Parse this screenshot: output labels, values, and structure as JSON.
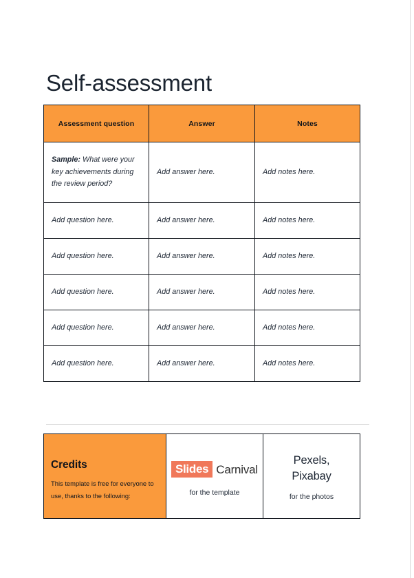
{
  "slide": {
    "title": "Self-assessment"
  },
  "table": {
    "headers": [
      "Assessment question",
      "Answer",
      "Notes"
    ],
    "rows": [
      {
        "question_label": "Sample:",
        "question": " What were your key achievements during the review period?",
        "answer": "Add answer here.",
        "notes": "Add notes here."
      },
      {
        "question": "Add question here.",
        "answer": "Add answer here.",
        "notes": "Add notes here."
      },
      {
        "question": "Add question here.",
        "answer": "Add answer here.",
        "notes": "Add notes here."
      },
      {
        "question": "Add question here.",
        "answer": "Add answer here.",
        "notes": "Add notes here."
      },
      {
        "question": "Add question here.",
        "answer": "Add answer here.",
        "notes": "Add notes here."
      },
      {
        "question": "Add question here.",
        "answer": "Add answer here.",
        "notes": "Add notes here."
      }
    ]
  },
  "credits": {
    "heading": "Credits",
    "body": "This template is free for everyone to use, thanks to the following:",
    "template_logo_part1": "Slides",
    "template_logo_part2": "Carnival",
    "template_caption": "for the template",
    "photos_names": "Pexels, Pixabay",
    "photos_name_line1": "Pexels,",
    "photos_name_line2": "Pixabay",
    "photos_caption": "for the photos"
  },
  "colors": {
    "accent_orange": "#fa9a3c",
    "logo_coral": "#f0785a",
    "text_dark": "#1d2633",
    "divider_gray": "#cbcbcb"
  }
}
